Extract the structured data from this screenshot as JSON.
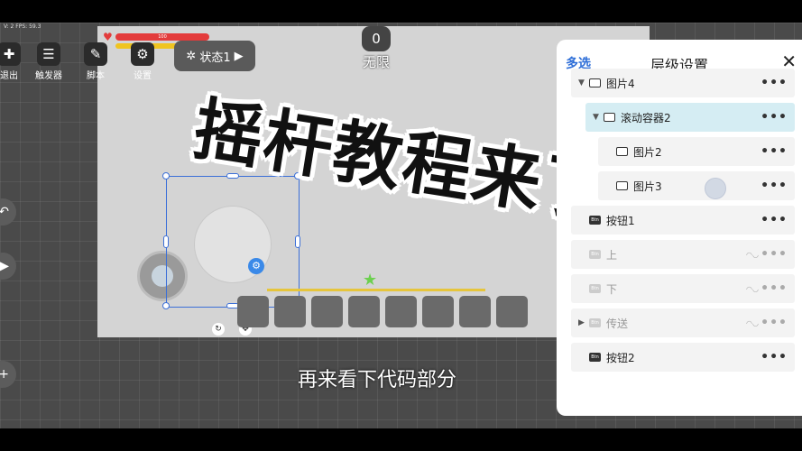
{
  "fps_text": "V: 2 FPS: 59.3",
  "top_toolbar": [
    {
      "label": "退出",
      "icon": "exit-icon"
    },
    {
      "label": "触发器",
      "icon": "trigger-icon"
    },
    {
      "label": "脚本",
      "icon": "script-icon"
    },
    {
      "label": "设置",
      "icon": "gear-icon"
    }
  ],
  "state_button": {
    "label": "状态1"
  },
  "hp": {
    "value": "100"
  },
  "counter": {
    "value": "0",
    "label": "无限"
  },
  "headline": "摇杆教程来了",
  "subtitle": "再来看下代码部分",
  "panel": {
    "multi_select": "多选",
    "title": "层级设置",
    "close_glyph": "✕",
    "layers": [
      {
        "name": "图片4",
        "type": "image",
        "indent": 0,
        "caret": "▼",
        "state": "normal"
      },
      {
        "name": "滚动容器2",
        "type": "image",
        "indent": 1,
        "caret": "▼",
        "state": "active"
      },
      {
        "name": "图片2",
        "type": "image",
        "indent": 2,
        "caret": "",
        "state": "normal"
      },
      {
        "name": "图片3",
        "type": "image",
        "indent": 2,
        "caret": "",
        "state": "normal"
      },
      {
        "name": "按钮1",
        "type": "button",
        "indent": 0,
        "caret": "",
        "state": "normal"
      },
      {
        "name": "上",
        "type": "button",
        "indent": 0,
        "caret": "",
        "state": "dim"
      },
      {
        "name": "下",
        "type": "button",
        "indent": 0,
        "caret": "",
        "state": "dim"
      },
      {
        "name": "传送",
        "type": "button",
        "indent": 0,
        "caret": "▶",
        "state": "dim"
      },
      {
        "name": "按钮2",
        "type": "button",
        "indent": 0,
        "caret": "",
        "state": "normal"
      }
    ],
    "more_glyph": "•••",
    "btn_type_label": "Btn"
  },
  "colors": {
    "accent": "#2f6fd8",
    "selection": "#3b6fd8",
    "active_row": "#d5edf3",
    "hp_red": "#e33b3b"
  }
}
